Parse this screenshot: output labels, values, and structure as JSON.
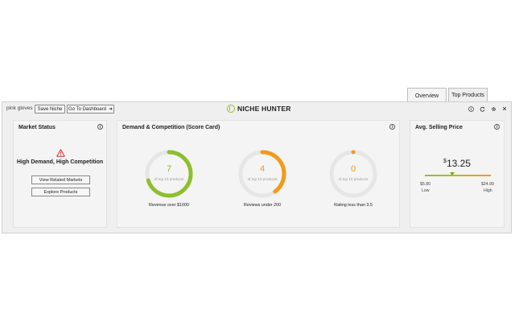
{
  "tabs": [
    {
      "label": "Overview",
      "active": true
    },
    {
      "label": "Top Products",
      "active": false
    }
  ],
  "topbar": {
    "search_term": "pink gloves",
    "save_label": "Save Niche",
    "dashboard_label": "Go To Dashboard",
    "logo_text": "NICHE HUNTER",
    "icons": [
      "info-icon",
      "refresh-icon",
      "gear-icon",
      "close-icon"
    ]
  },
  "market_status": {
    "title": "Market Status",
    "status": "High Demand, High Competition",
    "buttons": [
      "View Related Markets",
      "Explore Products"
    ]
  },
  "demand": {
    "title": "Demand & Competition (Score Card)",
    "metrics": [
      {
        "value": "7",
        "sub": "of top 10 products",
        "label": "Revenue over $1000",
        "fraction": 0.7,
        "color": "#8dbf2e"
      },
      {
        "value": "4",
        "sub": "of top 10 products",
        "label": "Reviews under 200",
        "fraction": 0.4,
        "color": "#f29a1d"
      },
      {
        "value": "0",
        "sub": "of top 10 products",
        "label": "Rating less than 3.5",
        "fraction": 0.0,
        "color": "#f29a1d"
      }
    ]
  },
  "price": {
    "title": "Avg. Selling Price",
    "currency": "$",
    "value": "13.25",
    "low_value": "$5.80",
    "low_label": "Low",
    "high_value": "$24.99",
    "high_label": "High"
  },
  "colors": {
    "green": "#8dbf2e",
    "orange": "#f29a1d",
    "track": "#e6e6e6",
    "warning": "#d32f2f"
  }
}
